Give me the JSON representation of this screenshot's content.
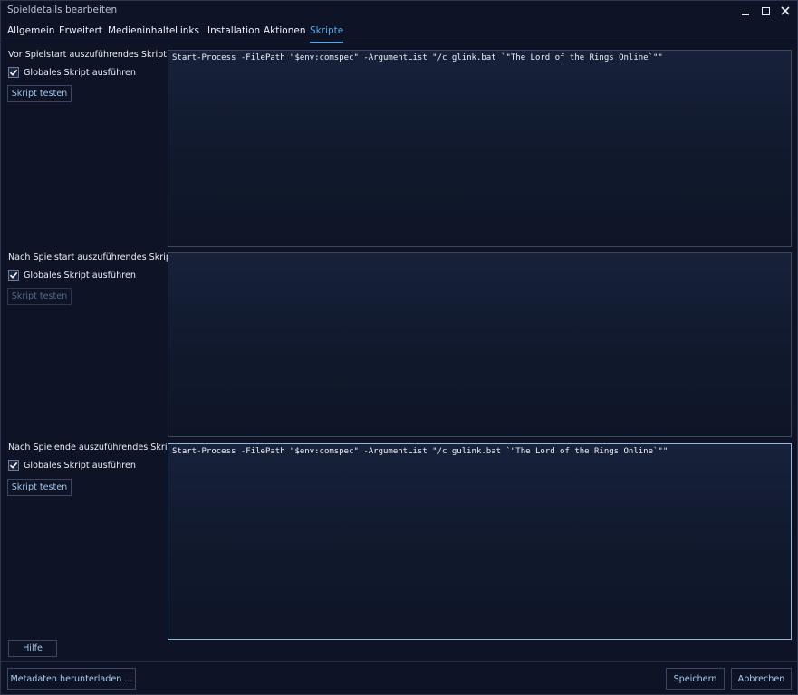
{
  "window": {
    "title": "Spieldetails bearbeiten"
  },
  "tabs": [
    {
      "label": "Allgemein",
      "active": false
    },
    {
      "label": "Erweitert",
      "active": false
    },
    {
      "label": "Medieninhalte",
      "active": false
    },
    {
      "label": "Links",
      "active": false
    },
    {
      "label": "Installation",
      "active": false
    },
    {
      "label": "Aktionen",
      "active": false
    },
    {
      "label": "Skripte",
      "active": true
    }
  ],
  "sections": [
    {
      "label": "Vor Spielstart auszuführendes Skript",
      "checkbox_label": "Globales Skript ausführen",
      "checked": true,
      "button_label": "Skript testen",
      "button_enabled": true,
      "script": "Start-Process -FilePath \"$env:comspec\" -ArgumentList \"/c glink.bat `\"The Lord of the Rings Online`\"\""
    },
    {
      "label": "Nach Spielstart auszuführendes Skript",
      "checkbox_label": "Globales Skript ausführen",
      "checked": true,
      "button_label": "Skript testen",
      "button_enabled": false,
      "script": ""
    },
    {
      "label": "Nach Spielende auszuführendes Skript",
      "checkbox_label": "Globales Skript ausführen",
      "checked": true,
      "button_label": "Skript testen",
      "button_enabled": true,
      "script": "Start-Process -FilePath \"$env:comspec\" -ArgumentList \"/c gulink.bat `\"The Lord of the Rings Online`\"\""
    }
  ],
  "buttons": {
    "help": "Hilfe",
    "download_metadata": "Metadaten herunterladen ...",
    "save": "Speichern",
    "cancel": "Abbrechen"
  },
  "colors": {
    "accent": "#58a6e8",
    "background": "#0e1425"
  }
}
